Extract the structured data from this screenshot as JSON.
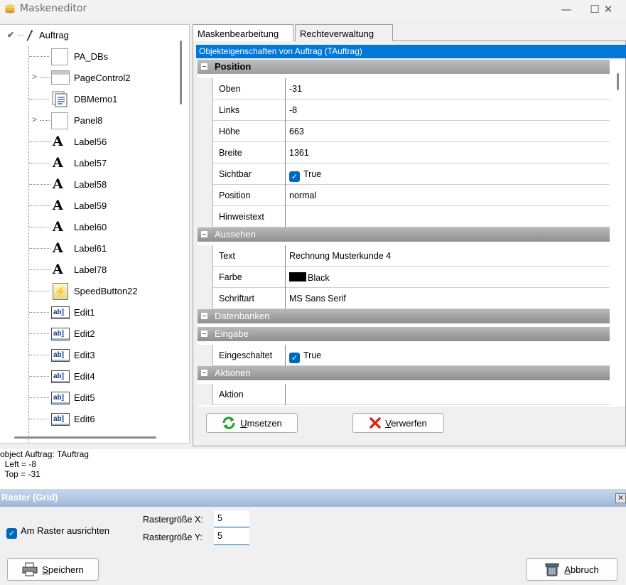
{
  "window": {
    "title": "Maskeneditor",
    "controls": [
      "—",
      "☐",
      "✕"
    ]
  },
  "tree": {
    "root": "Auftrag",
    "items": [
      {
        "label": "PA_DBs",
        "icon": "box-icon",
        "expandable": false
      },
      {
        "label": "PageControl2",
        "icon": "page-control-icon",
        "expandable": true
      },
      {
        "label": "DBMemo1",
        "icon": "memo-icon",
        "expandable": false
      },
      {
        "label": "Panel8",
        "icon": "box-icon",
        "expandable": true
      },
      {
        "label": "Label56",
        "icon": "label-icon",
        "expandable": false
      },
      {
        "label": "Label57",
        "icon": "label-icon",
        "expandable": false
      },
      {
        "label": "Label58",
        "icon": "label-icon",
        "expandable": false
      },
      {
        "label": "Label59",
        "icon": "label-icon",
        "expandable": false
      },
      {
        "label": "Label60",
        "icon": "label-icon",
        "expandable": false
      },
      {
        "label": "Label61",
        "icon": "label-icon",
        "expandable": false
      },
      {
        "label": "Label78",
        "icon": "label-icon",
        "expandable": false
      },
      {
        "label": "SpeedButton22",
        "icon": "speedbutton-icon",
        "expandable": false
      },
      {
        "label": "Edit1",
        "icon": "edit-icon",
        "expandable": false
      },
      {
        "label": "Edit2",
        "icon": "edit-icon",
        "expandable": false
      },
      {
        "label": "Edit3",
        "icon": "edit-icon",
        "expandable": false
      },
      {
        "label": "Edit4",
        "icon": "edit-icon",
        "expandable": false
      },
      {
        "label": "Edit5",
        "icon": "edit-icon",
        "expandable": false
      },
      {
        "label": "Edit6",
        "icon": "edit-icon",
        "expandable": false
      }
    ]
  },
  "tabs": [
    "Maskenbearbeitung",
    "Rechteverwaltung"
  ],
  "properties": {
    "header": "Objekteigenschaften von Auftrag (TAuftrag)",
    "position": {
      "title": "Position",
      "rows": [
        {
          "name": "Oben",
          "value": "-31"
        },
        {
          "name": "Links",
          "value": "-8"
        },
        {
          "name": "Höhe",
          "value": "663"
        },
        {
          "name": "Breite",
          "value": "1361"
        },
        {
          "name": "Sichtbar",
          "value": "True"
        },
        {
          "name": "Position",
          "value": "normal"
        },
        {
          "name": "Hinweistext",
          "value": ""
        }
      ]
    },
    "aussehen": {
      "title": "Aussehen",
      "rows": [
        {
          "name": "Text",
          "value": "Rechnung Musterkunde 4"
        },
        {
          "name": "Farbe",
          "value": "Black"
        },
        {
          "name": "Schriftart",
          "value": "MS Sans Serif"
        }
      ]
    },
    "datenbanken": {
      "title": "Datenbanken"
    },
    "eingabe": {
      "title": "Eingabe",
      "rows": [
        {
          "name": "Eingeschaltet",
          "value": "True"
        }
      ]
    },
    "aktionen": {
      "title": "Aktionen",
      "rows": [
        {
          "name": "Aktion",
          "value": ""
        }
      ]
    }
  },
  "buttons": {
    "umsetzen": {
      "mnemonic": "U",
      "rest": "msetzen"
    },
    "verwerfen": {
      "mnemonic": "V",
      "rest": "erwerfen"
    },
    "speichern": {
      "mnemonic": "S",
      "rest": "peichern"
    },
    "abbruch": {
      "mnemonic": "A",
      "rest": "bbruch"
    }
  },
  "log": {
    "lines": [
      "object Auftrag: TAuftrag",
      "  Left = -8",
      "  Top = -31"
    ]
  },
  "raster": {
    "title": "Raster (Grid)",
    "snap_label": "Am Raster ausrichten",
    "snap_checked": true,
    "x_label": "Rastergröße X:",
    "x_value": "5",
    "y_label": "Rastergröße Y:",
    "y_value": "5"
  },
  "colors": {
    "accent": "#0078d7",
    "checkbox": "#0067c0"
  }
}
